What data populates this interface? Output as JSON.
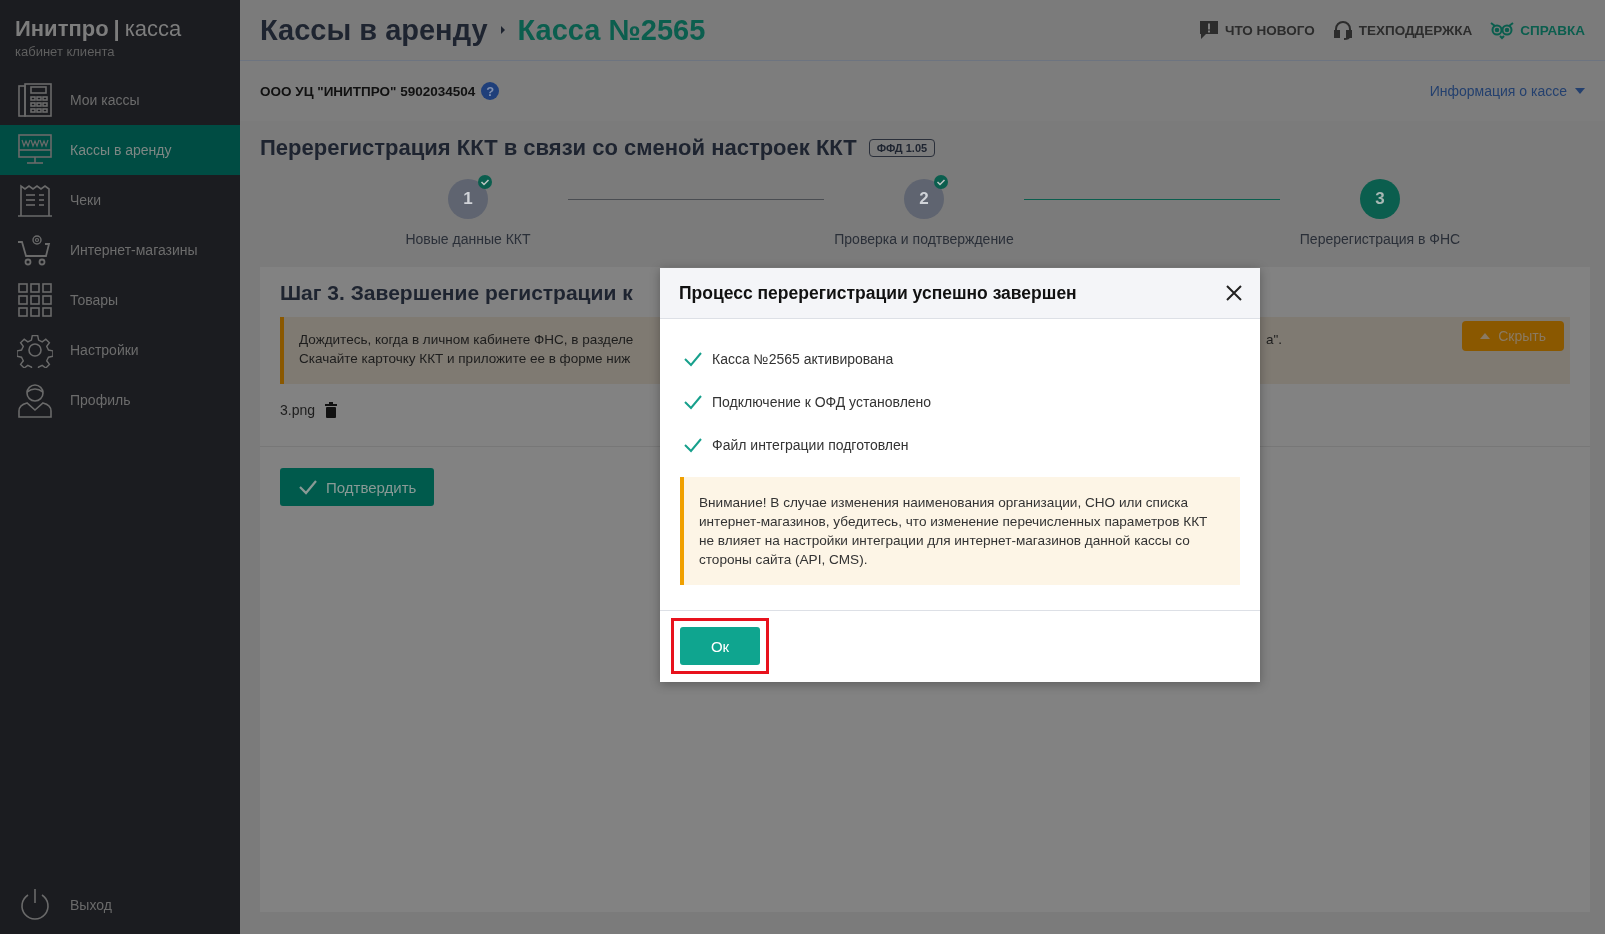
{
  "sidebar": {
    "logo": {
      "brand": "Инитпро",
      "separator": "|",
      "product": "касса"
    },
    "subtitle": "кабинет клиента",
    "items": [
      {
        "label": "Мои кассы",
        "kind": "register",
        "selected": false
      },
      {
        "label": "Кассы в аренду",
        "kind": "monitor",
        "selected": true
      },
      {
        "label": "Чеки",
        "kind": "receipt",
        "selected": false
      },
      {
        "label": "Интернет-магазины",
        "kind": "cart",
        "selected": false
      },
      {
        "label": "Товары",
        "kind": "grid",
        "selected": false
      },
      {
        "label": "Настройки",
        "kind": "gear",
        "selected": false
      },
      {
        "label": "Профиль",
        "kind": "person",
        "selected": false
      }
    ],
    "logout": "Выход"
  },
  "header": {
    "breadcrumb": [
      "Кассы в аренду",
      "Касса №2565"
    ],
    "links": [
      {
        "label": "ЧТО НОВОГО",
        "kind": "message",
        "accent": false
      },
      {
        "label": "ТЕХПОДДЕРЖКА",
        "kind": "headset",
        "accent": false
      },
      {
        "label": "СПРАВКА",
        "kind": "owl",
        "accent": true
      }
    ]
  },
  "org": {
    "name": "ООО УЦ \"ИНИТПРО\" 5902034504",
    "help": "?",
    "info_link": "Информация о кассе"
  },
  "page": {
    "title": "Перерегистрация ККТ в связи со сменой настроек ККТ",
    "badge": "ФФД 1.05"
  },
  "steps": [
    {
      "number": "1",
      "label": "Новые данные ККТ",
      "done": true,
      "selected": false
    },
    {
      "number": "2",
      "label": "Проверка и подтверждение",
      "done": true,
      "selected": false
    },
    {
      "number": "3",
      "label": "Перерегистрация в ФНС",
      "done": false,
      "selected": true
    }
  ],
  "card": {
    "heading": "Шаг 3. Завершение регистрации к",
    "notice_lines": [
      "Дождитесь, когда в личном кабинете ФНС, в разделе",
      "Скачайте карточку ККТ и приложите ее в форме ниж"
    ],
    "notice_tail": "а\".",
    "hide_button": "Скрыть",
    "file": "3.png",
    "confirm_button": "Подтвердить"
  },
  "modal": {
    "title": "Процесс перерегистрации успешно завершен",
    "items": [
      "Касса №2565 активирована",
      "Подключение к ОФД установлено",
      "Файл интеграции подготовлен"
    ],
    "warning": "Внимание! В случае изменения наименования организации, СНО или списка интернет-магазинов, убедитесь, что изменение перечисленных параметров ККТ не влияет на настройки интеграции для интернет-магазинов данной кассы со стороны сайта (API, CMS).",
    "ok_button": "Ок"
  }
}
